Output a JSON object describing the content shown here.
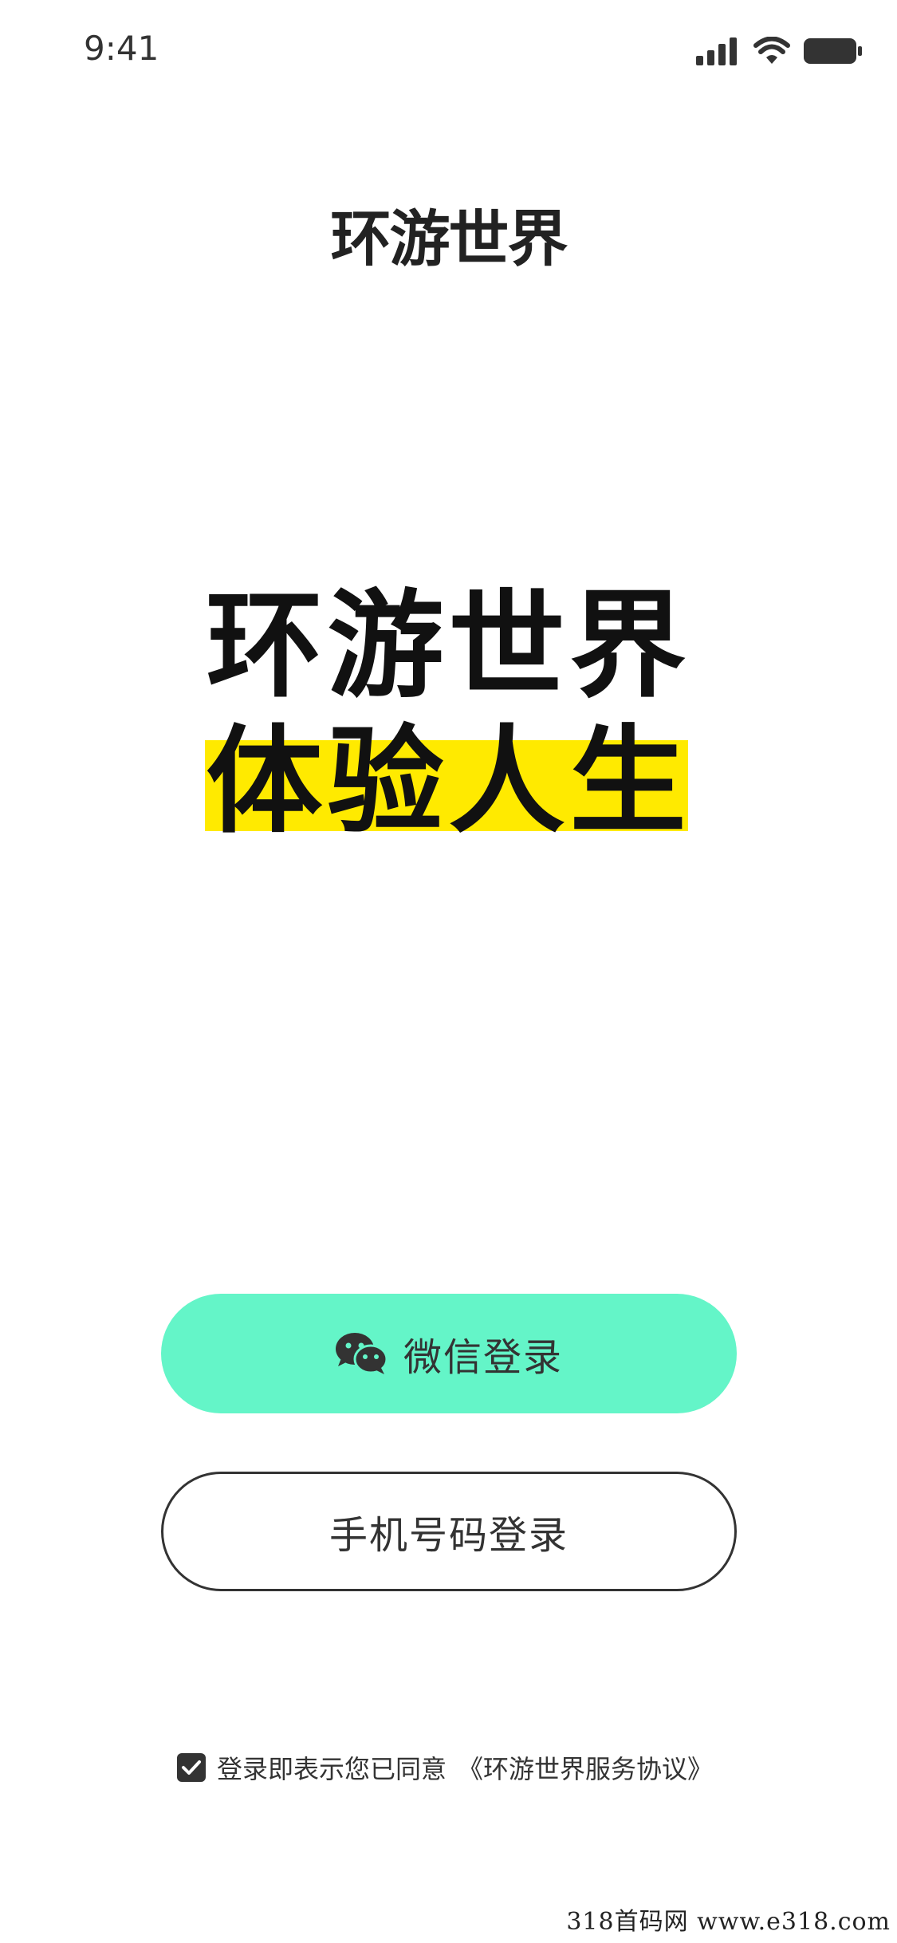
{
  "status_bar": {
    "time": "9:41",
    "icons": [
      "signal-icon",
      "wifi-icon",
      "battery-icon"
    ]
  },
  "logo": {
    "text": "环游世界"
  },
  "hero": {
    "line1": "环游世界",
    "line2": "体验人生",
    "highlight_color": "#ffea00"
  },
  "buttons": {
    "wechat_login": {
      "label": "微信登录",
      "icon": "wechat-icon",
      "color": "#64f5c8"
    },
    "phone_login": {
      "label": "手机号码登录"
    }
  },
  "agreement": {
    "checked": true,
    "text": "登录即表示您已同意",
    "link": "《环游世界服务协议》"
  },
  "watermark": {
    "text": "318首码网 www.e318.com"
  }
}
